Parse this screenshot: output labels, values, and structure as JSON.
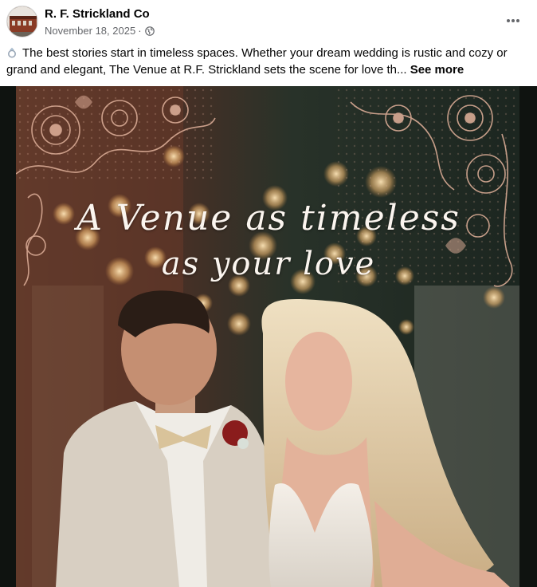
{
  "post": {
    "page_name": "R. F. Strickland Co",
    "date": "November 18, 2025",
    "separator": "·",
    "privacy_icon": "globe-icon",
    "more_icon": "more-options-icon"
  },
  "caption": {
    "icon": "ring-icon",
    "text": "The best stories start in timeless spaces. Whether your dream wedding is rustic and cozy or grand and elegant, The Venue at R.F. Strickland sets the scene for love th...",
    "see_more": "See more"
  },
  "image": {
    "line1": "A Venue as timeless",
    "line2": "as your love",
    "colors": {
      "lace": "#d9ab95",
      "background": "#0f1310"
    }
  }
}
